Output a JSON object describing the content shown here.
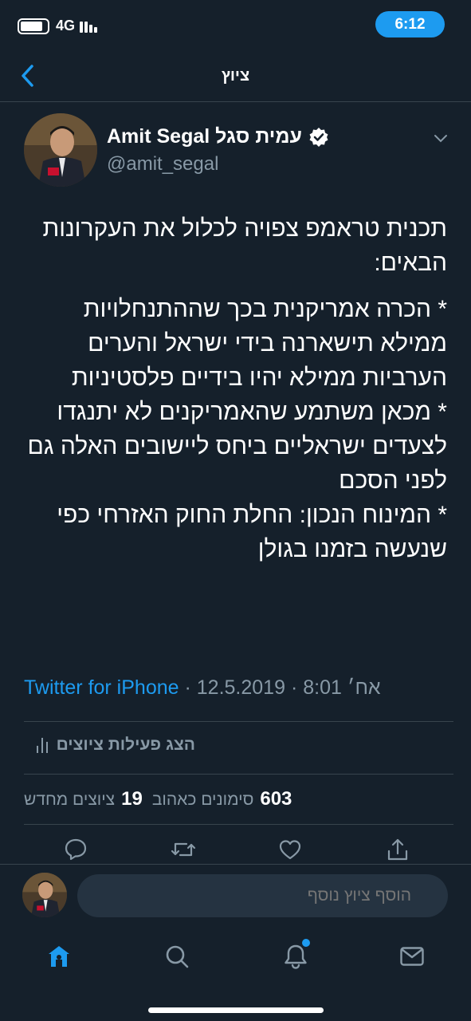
{
  "status_bar": {
    "network": "4G",
    "time": "6:12",
    "battery_level": 0.85
  },
  "nav": {
    "back_icon": "chevron-left-icon",
    "title": "ציוץ"
  },
  "author": {
    "display_name": "Amit Segal עמית סגל",
    "verified_icon": "verified-badge-icon",
    "handle": "@amit_segal"
  },
  "tweet": {
    "paragraphs": [
      "תכנית טראמפ צפויה לכלול את העקרונות הבאים:",
      "* הכרה אמריקנית בכך שההתנחלויות ממילא תישארנה בידי ישראל והערים הערביות ממילא יהיו בידיים פלסטיניות",
      "* מכאן משתמע שהאמריקנים לא יתנגדו לצעדים ישראליים ביחס ליישובים האלה גם לפני הסכם",
      "* המינוח הנכון: החלת החוק האזרחי כפי שנעשה בזמנו בגולן"
    ]
  },
  "meta": {
    "time": "8:01 אח׳",
    "date": "12.5.2019",
    "separator": "·",
    "source": "Twitter for iPhone"
  },
  "activity": {
    "label": "הצג פעילות ציוצים",
    "icon": "bar-chart-icon"
  },
  "stats": {
    "likes_count": "603",
    "likes_label": "סימונים כאהוב",
    "retweets_count": "19",
    "retweets_label": "ציוצים מחדש"
  },
  "actions": [
    "reply-icon",
    "retweet-icon",
    "like-icon",
    "share-icon"
  ],
  "reply": {
    "placeholder": "הוסף ציוץ נוסף"
  },
  "tab_bar": {
    "tabs": [
      "home-icon",
      "search-icon",
      "notifications-icon",
      "messages-icon"
    ],
    "accent": "#1d9bf0"
  }
}
